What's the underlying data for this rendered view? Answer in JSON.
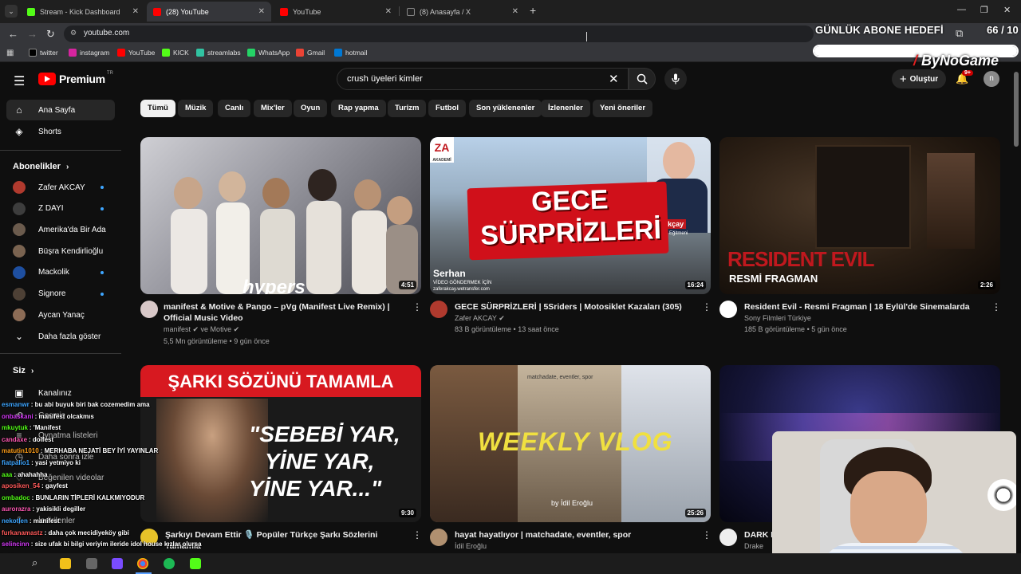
{
  "browser": {
    "tabs": [
      {
        "title": "Stream - Kick Dashboard",
        "active": false,
        "favicon_color": "#53fc18"
      },
      {
        "title": "(28) YouTube",
        "active": true,
        "favicon_color": "#ff0000"
      },
      {
        "title": "YouTube",
        "active": false,
        "favicon_color": "#ff0000"
      },
      {
        "title": "(8) Anasayfa / X",
        "active": false,
        "favicon_color": "#ffffff"
      }
    ],
    "url": "youtube.com",
    "bookmarks": [
      {
        "label": "twitter",
        "icon": "x-icon",
        "color": "#000000"
      },
      {
        "label": "instagram",
        "icon": "instagram-icon",
        "color": "#d6249f"
      },
      {
        "label": "YouTube",
        "icon": "youtube-icon",
        "color": "#ff0000"
      },
      {
        "label": "KICK",
        "icon": "kick-icon",
        "color": "#53fc18"
      },
      {
        "label": "streamlabs",
        "icon": "streamlabs-icon",
        "color": "#31c3a2"
      },
      {
        "label": "WhatsApp",
        "icon": "whatsapp-icon",
        "color": "#25d366"
      },
      {
        "label": "Gmail",
        "icon": "gmail-icon",
        "color": "#ea4335"
      },
      {
        "label": "hotmail",
        "icon": "hotmail-icon",
        "color": "#0078d4"
      }
    ]
  },
  "overlay": {
    "goal_title": "GÜNLÜK ABONE HEDEFİ",
    "goal_count": "66 / 10",
    "goal_progress": 1.0,
    "brand_name": "ByNoGame"
  },
  "youtube": {
    "logo_text": "Premium",
    "logo_superscript": "TR",
    "search_value": "crush üyeleri kimler",
    "create_label": "Oluştur",
    "notification_count": "9+",
    "avatar_letter": "n",
    "sidebar": {
      "main": [
        {
          "label": "Ana Sayfa",
          "icon": "home-icon",
          "active": true
        },
        {
          "label": "Shorts",
          "icon": "shorts-icon",
          "active": false
        }
      ],
      "subscriptions_title": "Abonelikler",
      "subscriptions": [
        {
          "label": "Zafer AKCAY",
          "color": "#b03a2e",
          "dot": true
        },
        {
          "label": "Z DAYI",
          "color": "#3d3d3d",
          "dot": true
        },
        {
          "label": "Amerika'da Bir Ada",
          "color": "#6b5b4d",
          "dot": false
        },
        {
          "label": "Büşra Kendirlioğlu",
          "color": "#7a6350",
          "dot": false
        },
        {
          "label": "Mackolik",
          "color": "#1e4fa0",
          "dot": true
        },
        {
          "label": "Signore",
          "color": "#4d4035",
          "dot": true
        },
        {
          "label": "Aycan Yanaç",
          "color": "#8c6c56",
          "dot": false
        }
      ],
      "show_more": "Daha fazla göster",
      "you_title": "Siz",
      "you_items": [
        "Kanalınız",
        "Geçmiş",
        "Oynatma listeleri",
        "Daha sonra izle",
        "Beğenilen videolar",
        "İndirilenler"
      ]
    },
    "chips": [
      "Tümü",
      "Müzik",
      "Canlı",
      "Mix'ler",
      "Oyun",
      "Rap yapma",
      "Turizm",
      "Futbol",
      "Son yüklenenler",
      "İzlenenler",
      "Yeni öneriler"
    ],
    "videos": [
      {
        "title": "manifest & Motive & Pango – pVg (Manifest Live Remix) | Official Music Video",
        "channel": "manifest ✔ ve Motive ✔",
        "views": "5,5 Mn görüntüleme",
        "age": "9 gün önce",
        "duration": "4:51",
        "thumb_text": "hypers"
      },
      {
        "title": "GECE SÜRPRİZLERİ | 5Sriders | Motosiklet Kazaları (305)",
        "channel": "Zafer AKCAY ✔",
        "views": "83 B görüntüleme",
        "age": "13 saat önce",
        "duration": "16:24",
        "thumb_text": "GECE SÜRPRİZLERİ",
        "thumb_sub": "Serhan",
        "thumb_note": "VİDEO GÖNDERMEK İÇİN",
        "thumb_url": "zaferakcay.wetransfer.com",
        "thumb_badge": "ZA",
        "thumb_badge_sub": "AKADEMİ",
        "thumb_name": "r Akçay",
        "thumb_role": "rüş Eğitmeni"
      },
      {
        "title": "Resident Evil - Resmi Fragman | 18 Eylül'de Sinemalarda",
        "channel": "Sony Filmleri Türkiye",
        "views": "185 B görüntüleme",
        "age": "5 gün önce",
        "duration": "2:26",
        "thumb_text": "RESIDENT EVIL",
        "thumb_sub": "RESMİ FRAGMAN"
      },
      {
        "title": "Şarkıyı Devam Ettir 🎙️ Popüler Türkçe Şarkı Sözlerini Tamamla",
        "channel": "",
        "views": "",
        "age": "",
        "duration": "9:30",
        "thumb_text": "ŞARKI SÖZÜNÜ TAMAMLA",
        "thumb_quote_1": "\"SEBEBİ YAR,",
        "thumb_quote_2": "YİNE YAR,",
        "thumb_quote_3": "YİNE YAR...\""
      },
      {
        "title": "hayat hayatlıyor | matchadate, eventler, spor",
        "channel": "İdil Eroğlu",
        "views": "",
        "age": "",
        "duration": "25:26",
        "thumb_text": "WEEKLY VLOG",
        "thumb_sub": "by İdil Eroğlu",
        "thumb_tag": "matchadate, eventler, spor"
      },
      {
        "title": "DARK L",
        "channel": "Drake",
        "views": "",
        "age": "",
        "duration": ""
      }
    ]
  },
  "chat": [
    {
      "user": "esmanwr",
      "text": ": bu abi buyuk biri bak cozemedim ama",
      "color": "#3ea6ff"
    },
    {
      "user": "onbaskani",
      "text": ": manifest olcakmıs",
      "color": "#d63af9"
    },
    {
      "user": "mkuytuk",
      "text": ": 'Manifest",
      "color": "#53fc18"
    },
    {
      "user": "candaxe",
      "text": ": dolfest",
      "color": "#ff5ab4"
    },
    {
      "user": "matutin1010",
      "text": ": MERHABA NEJATİ BEY İYİ YAYINLAR",
      "color": "#ff9f1a"
    },
    {
      "user": "fiatpalio1",
      "text": ": yasi yetmiyo ki",
      "color": "#3ea6ff"
    },
    {
      "user": "aaa",
      "text": ": ahahahha",
      "color": "#53fc18"
    },
    {
      "user": "aposiken_54",
      "text": ": gayfest",
      "color": "#ff5a5a"
    },
    {
      "user": "ombadoc",
      "text": ": BUNLARIN TİPLERİ KALKMIYODUR",
      "color": "#53fc18"
    },
    {
      "user": "aurorazra",
      "text": ": yakisikli degiller",
      "color": "#ff5ab4"
    },
    {
      "user": "nekotlen",
      "text": ": manifest",
      "color": "#3ea6ff"
    },
    {
      "user": "furkanamastz",
      "text": ": daha çok mecidiyeköy gibi",
      "color": "#ff5a5a"
    },
    {
      "user": "selincinn",
      "text": ": size ufak bi bilgi veriyim ileride idol house kızlar olursa",
      "color": "#d63af9"
    },
    {
      "user": "katılıyorum",
      "text": "",
      "color": "#ffffff"
    }
  ]
}
